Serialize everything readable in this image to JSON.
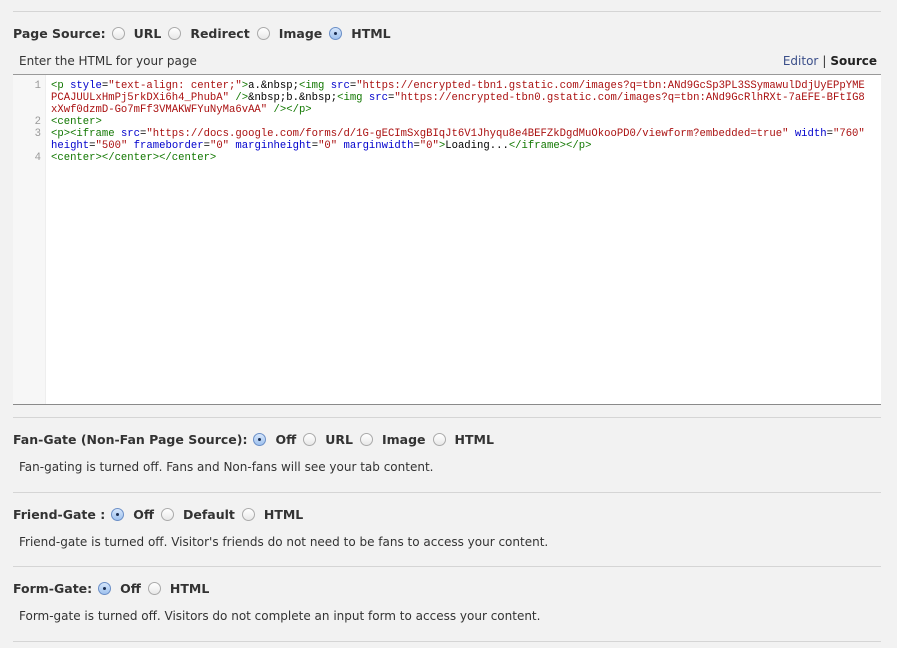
{
  "page_source": {
    "label": "Page Source:",
    "options": [
      {
        "label": "URL",
        "selected": false
      },
      {
        "label": "Redirect",
        "selected": false
      },
      {
        "label": "Image",
        "selected": false
      },
      {
        "label": "HTML",
        "selected": true
      }
    ]
  },
  "editor": {
    "instruction": "Enter the HTML for your page",
    "mode_links": {
      "editor": "Editor",
      "separator": "|",
      "source": "Source"
    },
    "lines": [
      {
        "number": "1",
        "tokens": [
          {
            "t": "tag",
            "v": "<p "
          },
          {
            "t": "attr",
            "v": "style"
          },
          {
            "t": "plain",
            "v": "="
          },
          {
            "t": "str",
            "v": "\"text-align: center;\""
          },
          {
            "t": "tag",
            "v": ">"
          },
          {
            "t": "plain",
            "v": "a.&nbsp;"
          },
          {
            "t": "tag",
            "v": "<img "
          },
          {
            "t": "attr",
            "v": "src"
          },
          {
            "t": "plain",
            "v": "="
          },
          {
            "t": "str",
            "v": "\"https://encrypted-tbn1.gstatic.com/images?q=tbn:ANd9GcSp3PL3SSymawulDdjUyEPpYMEPCAJUULxHmPj5rkDXi6h4_PhubA\""
          },
          {
            "t": "tag",
            "v": " />"
          },
          {
            "t": "plain",
            "v": "&nbsp;b.&nbsp;"
          },
          {
            "t": "tag",
            "v": "<img "
          },
          {
            "t": "attr",
            "v": "src"
          },
          {
            "t": "plain",
            "v": "="
          },
          {
            "t": "str",
            "v": "\"https://encrypted-tbn0.gstatic.com/images?q=tbn:ANd9GcRlhRXt-7aEFE-BFtIG8xXwf0dzmD-Go7mFf3VMAKWFYuNyMa6vAA\""
          },
          {
            "t": "tag",
            "v": " /></p>"
          }
        ]
      },
      {
        "number": "2",
        "tokens": [
          {
            "t": "tag",
            "v": "<center>"
          }
        ]
      },
      {
        "number": "3",
        "tokens": [
          {
            "t": "tag",
            "v": "<p><iframe "
          },
          {
            "t": "attr",
            "v": "src"
          },
          {
            "t": "plain",
            "v": "="
          },
          {
            "t": "str",
            "v": "\"https://docs.google.com/forms/d/1G-gECImSxgBIqJt6V1Jhyqu8e4BEFZkDgdMuOkooPD0/viewform?embedded=true\""
          },
          {
            "t": "plain",
            "v": " "
          },
          {
            "t": "attr",
            "v": "width"
          },
          {
            "t": "plain",
            "v": "="
          },
          {
            "t": "str",
            "v": "\"760\""
          },
          {
            "t": "plain",
            "v": " "
          },
          {
            "t": "attr",
            "v": "height"
          },
          {
            "t": "plain",
            "v": "="
          },
          {
            "t": "str",
            "v": "\"500\""
          },
          {
            "t": "plain",
            "v": " "
          },
          {
            "t": "attr",
            "v": "frameborder"
          },
          {
            "t": "plain",
            "v": "="
          },
          {
            "t": "str",
            "v": "\"0\""
          },
          {
            "t": "plain",
            "v": " "
          },
          {
            "t": "attr",
            "v": "marginheight"
          },
          {
            "t": "plain",
            "v": "="
          },
          {
            "t": "str",
            "v": "\"0\""
          },
          {
            "t": "plain",
            "v": " "
          },
          {
            "t": "attr",
            "v": "marginwidth"
          },
          {
            "t": "plain",
            "v": "="
          },
          {
            "t": "str",
            "v": "\"0\""
          },
          {
            "t": "tag",
            "v": ">"
          },
          {
            "t": "plain",
            "v": "Loading..."
          },
          {
            "t": "tag",
            "v": "</iframe></p>"
          }
        ]
      },
      {
        "number": "4",
        "tokens": [
          {
            "t": "tag",
            "v": "<center></center></center>"
          }
        ]
      }
    ]
  },
  "fan_gate": {
    "label": "Fan-Gate (Non-Fan Page Source):",
    "options": [
      {
        "label": "Off",
        "selected": true
      },
      {
        "label": "URL",
        "selected": false
      },
      {
        "label": "Image",
        "selected": false
      },
      {
        "label": "HTML",
        "selected": false
      }
    ],
    "description": "Fan-gating is turned off. Fans and Non-fans will see your tab content."
  },
  "friend_gate": {
    "label": "Friend-Gate :",
    "options": [
      {
        "label": "Off",
        "selected": true
      },
      {
        "label": "Default",
        "selected": false
      },
      {
        "label": "HTML",
        "selected": false
      }
    ],
    "description": "Friend-gate is turned off. Visitor's friends do not need to be fans to access your content."
  },
  "form_gate": {
    "label": "Form-Gate:",
    "options": [
      {
        "label": "Off",
        "selected": true
      },
      {
        "label": "HTML",
        "selected": false
      }
    ],
    "description": "Form-gate is turned off. Visitors do not complete an input form to access your content."
  }
}
